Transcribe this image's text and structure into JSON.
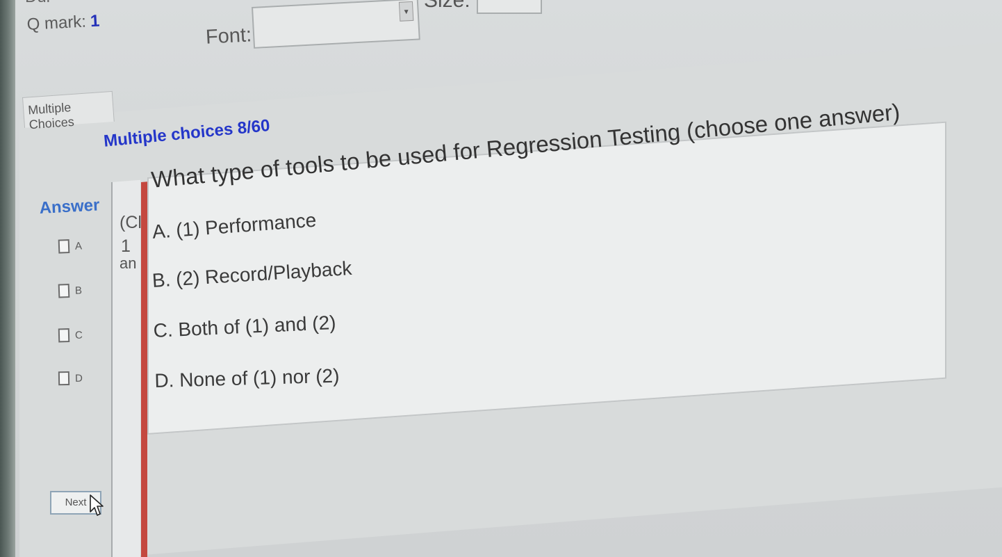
{
  "header": {
    "top_clip_left": "Dur",
    "q_mark_label": "Q mark:",
    "q_mark_value": "1",
    "font_label": "Font:",
    "size_label": "Size:"
  },
  "tab": {
    "label": "Multiple Choices"
  },
  "quiz": {
    "heading": "Multiple choices 8/60",
    "answer_label": "Answer",
    "answer_options": [
      "A",
      "B",
      "C",
      "D"
    ],
    "clipped_column": [
      "(Cl",
      "1",
      "an"
    ],
    "question": "What type of tools to be used for Regression Testing (choose one answer)",
    "options": [
      "A. (1) Performance",
      "B. (2) Record/Playback",
      "C. Both of (1) and (2)",
      "D. None of (1) nor (2)"
    ],
    "next_label": "Next"
  },
  "colors": {
    "heading": "#2436c9",
    "answer_label": "#3a6fc9",
    "q_mark_value": "#2330b8",
    "red_bar": "#c4483f"
  }
}
